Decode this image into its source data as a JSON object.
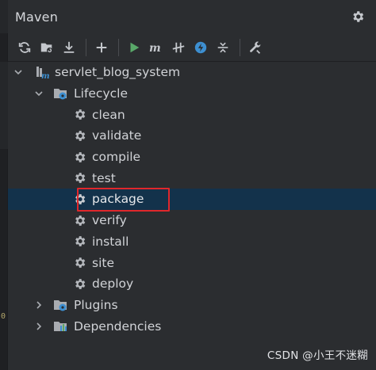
{
  "panel": {
    "title": "Maven"
  },
  "toolbar": {
    "buttons": [
      {
        "name": "reload-icon"
      },
      {
        "name": "add-projects-icon"
      },
      {
        "name": "download-icon"
      },
      {
        "name": "add-icon"
      },
      {
        "name": "run-icon"
      },
      {
        "name": "execute-goal-icon"
      },
      {
        "name": "skip-tests-icon"
      },
      {
        "name": "offline-mode-icon"
      },
      {
        "name": "collapse-all-icon"
      },
      {
        "name": "settings-wrench-icon"
      }
    ]
  },
  "tree": {
    "project": "servlet_blog_system",
    "lifecycle": "Lifecycle",
    "goals": [
      "clean",
      "validate",
      "compile",
      "test",
      "package",
      "verify",
      "install",
      "site",
      "deploy"
    ],
    "plugins": "Plugins",
    "dependencies": "Dependencies",
    "selected_goal": "package"
  },
  "editor_gutter": {
    "digit": "0"
  },
  "watermark": "CSDN @小王不迷糊",
  "colors": {
    "selection": "#13324b",
    "highlight_border": "#e0272b",
    "run_green": "#59a869",
    "offline_blue": "#3d8fd1"
  }
}
